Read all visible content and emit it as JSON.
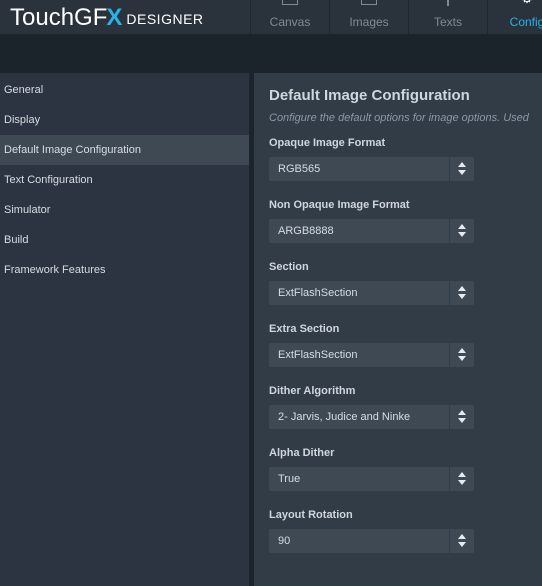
{
  "app": {
    "logo_main": "Touch",
    "logo_gfx": "GF",
    "logo_x": "X",
    "logo_sub": "DESIGNER"
  },
  "tabs": [
    {
      "label": "Canvas",
      "icon": "canvas-icon",
      "active": false
    },
    {
      "label": "Images",
      "icon": "images-icon",
      "active": false
    },
    {
      "label": "Texts",
      "icon": "texts-icon",
      "active": false
    },
    {
      "label": "Config",
      "icon": "gear-icon",
      "active": true
    }
  ],
  "sidebar": {
    "items": [
      {
        "label": "General"
      },
      {
        "label": "Display"
      },
      {
        "label": "Default Image Configuration",
        "active": true
      },
      {
        "label": "Text Configuration"
      },
      {
        "label": "Simulator"
      },
      {
        "label": "Build"
      },
      {
        "label": "Framework Features"
      }
    ]
  },
  "main": {
    "title": "Default Image Configuration",
    "subtitle": "Configure the default options for image options. Used",
    "fields": [
      {
        "label": "Opaque Image Format",
        "value": "RGB565"
      },
      {
        "label": "Non Opaque Image Format",
        "value": "ARGB8888"
      },
      {
        "label": "Section",
        "value": "ExtFlashSection"
      },
      {
        "label": "Extra Section",
        "value": "ExtFlashSection"
      },
      {
        "label": "Dither Algorithm",
        "value": "2- Jarvis, Judice and Ninke"
      },
      {
        "label": "Alpha Dither",
        "value": "True"
      },
      {
        "label": "Layout Rotation",
        "value": "90"
      }
    ]
  },
  "colors": {
    "accent": "#27b2e8",
    "background": "#2b3440",
    "panel": "#323c47",
    "band": "#1b232b"
  }
}
